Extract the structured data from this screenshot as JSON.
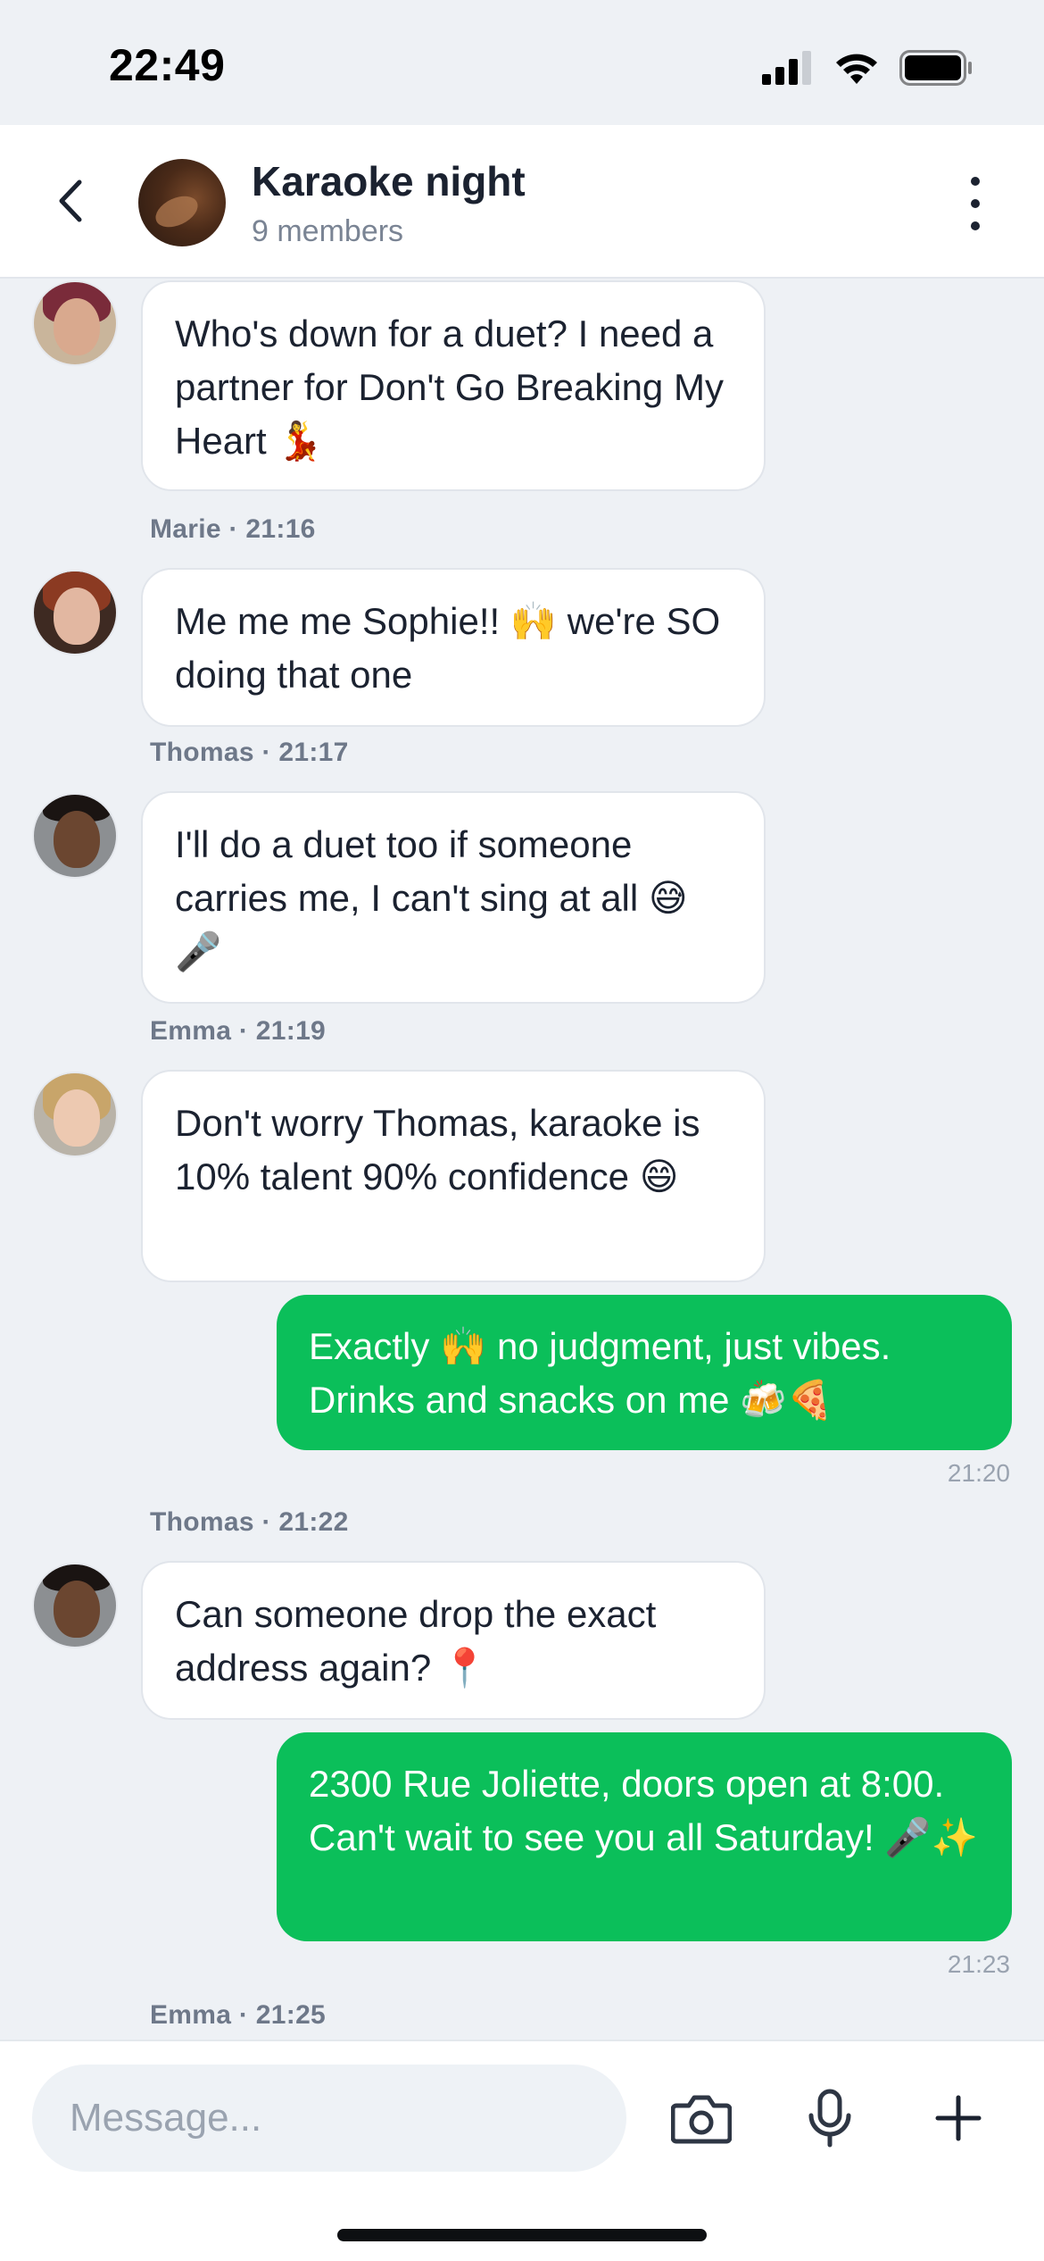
{
  "status_bar": {
    "time": "22:49"
  },
  "header": {
    "title": "Karaoke night",
    "subtitle": "9 members"
  },
  "messages": [
    {
      "sender": "",
      "text": "Who's down for a duet? I need a partner for Don't Go Breaking My Heart 💃"
    },
    {
      "sender": "Marie · 21:16",
      "text": "Me me me Sophie!! 🙌 we're SO doing that one"
    },
    {
      "sender": "Thomas · 21:17",
      "text": "I'll do a duet too if someone carries me, I can't sing at all 😅🎤"
    },
    {
      "sender": "Emma · 21:19",
      "text": "Don't worry Thomas, karaoke is 10% talent 90% confidence 😄"
    },
    {
      "text": "Exactly 🙌 no judgment, just vibes. Drinks and snacks on me 🍻🍕",
      "time": "21:20"
    },
    {
      "sender": "Thomas · 21:22",
      "text": "Can someone drop the exact address again? 📍"
    },
    {
      "text": "2300 Rue Joliette, doors open at 8:00. Can't wait to see you all Saturday! 🎤✨",
      "time": "21:23"
    },
    {
      "sender": "Emma · 21:25"
    }
  ],
  "composer": {
    "placeholder": "Message..."
  },
  "icons": {
    "back": "chevron-left-icon",
    "more": "more-vertical-icon",
    "camera": "camera-icon",
    "mic": "microphone-icon",
    "add": "plus-icon"
  },
  "colors": {
    "outgoing_bubble": "#0BBF5A",
    "background": "#EEF1F5"
  }
}
